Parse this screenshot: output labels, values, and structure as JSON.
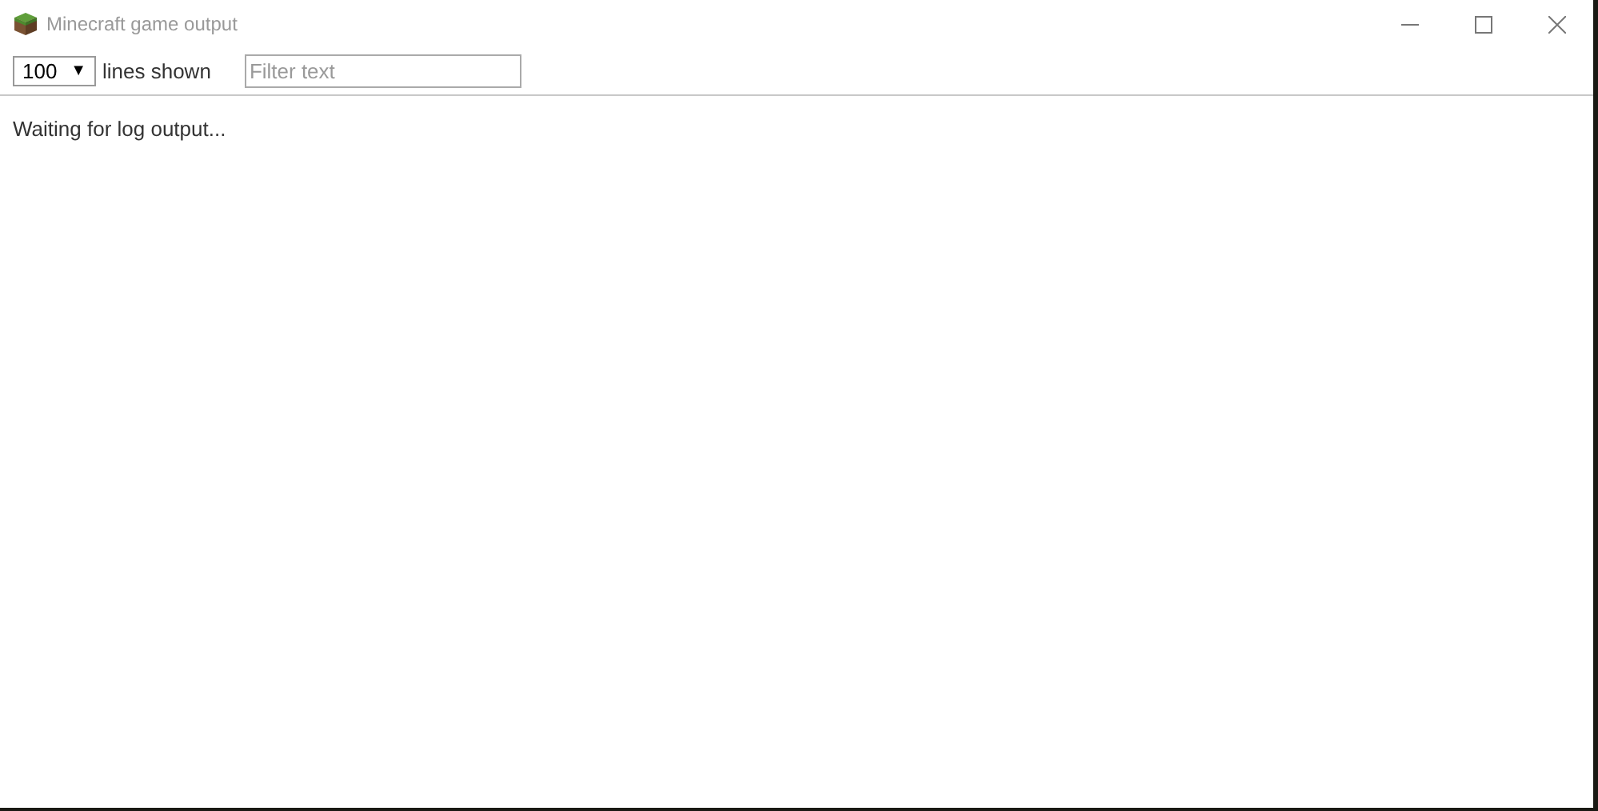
{
  "window": {
    "title": "Minecraft game output"
  },
  "toolbar": {
    "lines_select": {
      "value": "100",
      "arrow": "▼"
    },
    "lines_label": "lines shown",
    "filter": {
      "placeholder": "Filter text"
    }
  },
  "log": {
    "message": "Waiting for log output..."
  }
}
